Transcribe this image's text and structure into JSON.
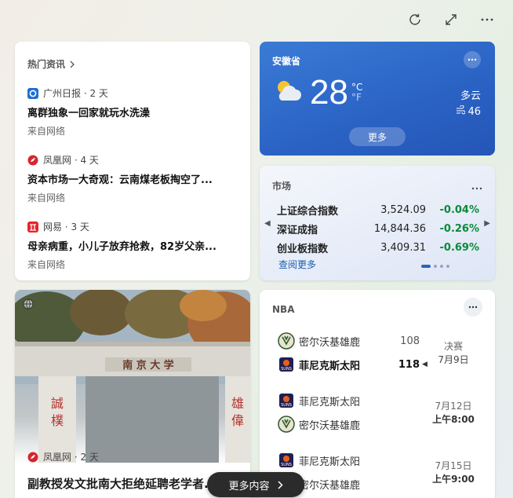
{
  "news": {
    "title": "热门资讯",
    "items": [
      {
        "source": "广州日报 · 2 天",
        "headline": "离群独象一回家就玩水洗澡",
        "from": "来自网络"
      },
      {
        "source": "凤凰网 · 4 天",
        "headline": "资本市场一大奇观：云南煤老板掏空了...",
        "from": "来自网络"
      },
      {
        "source": "网易 · 3 天",
        "headline": "母亲病重，小儿子放弃抢救，82岁父亲...",
        "from": "来自网络"
      }
    ]
  },
  "weather": {
    "location": "安徽省",
    "temp": "28",
    "unit_c": "°C",
    "unit_f": "°F",
    "condition": "多云",
    "aqi": "46",
    "more_label": "更多"
  },
  "market": {
    "title": "市场",
    "rows": [
      {
        "name": "上证综合指数",
        "value": "3,524.09",
        "change": "-0.04%"
      },
      {
        "name": "深证成指",
        "value": "14,844.36",
        "change": "-0.26%"
      },
      {
        "name": "创业板指数",
        "value": "3,409.31",
        "change": "-0.69%"
      }
    ],
    "link": "查阅更多",
    "change_color": "#0a8a3a"
  },
  "photo_news": {
    "source": "凤凰网 · 2 天",
    "headline": "副教授发文批南大拒绝延聘老学者..."
  },
  "nba": {
    "title": "NBA",
    "games": [
      {
        "team1": "密尔沃基雄鹿",
        "score1": "108",
        "team2": "菲尼克斯太阳",
        "score2": "118",
        "status1": "决赛",
        "status2": "7月9日"
      },
      {
        "team1": "菲尼克斯太阳",
        "score1": "",
        "team2": "密尔沃基雄鹿",
        "score2": "",
        "status1": "7月12日",
        "status2": "上午8:00"
      },
      {
        "team1": "菲尼克斯太阳",
        "score1": "",
        "team2": "密尔沃基雄鹿",
        "score2": "",
        "status1": "7月15日",
        "status2": "上午9:00"
      }
    ]
  },
  "more_content_label": "更多内容"
}
